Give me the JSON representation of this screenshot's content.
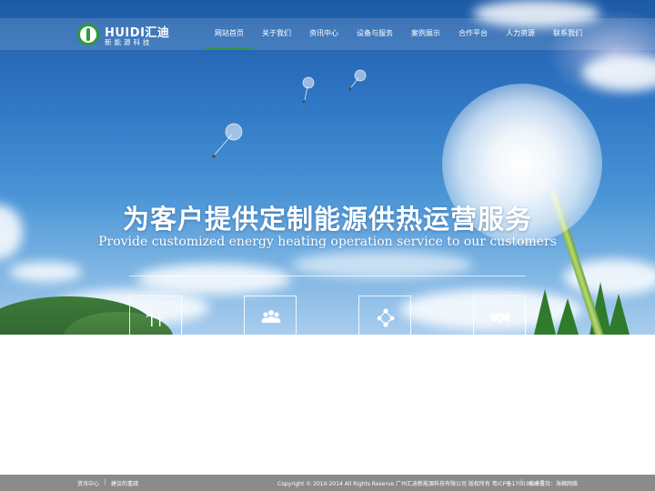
{
  "header": {
    "logo": {
      "name": "HUIDI汇迪",
      "tagline": "新能源科技"
    },
    "nav": [
      {
        "label": "网站首页",
        "active": true
      },
      {
        "label": "关于我们",
        "active": false
      },
      {
        "label": "资讯中心",
        "active": false
      },
      {
        "label": "设备与服务",
        "active": false
      },
      {
        "label": "案例展示",
        "active": false
      },
      {
        "label": "合作平台",
        "active": false
      },
      {
        "label": "人力资源",
        "active": false
      },
      {
        "label": "联系我们",
        "active": false
      }
    ]
  },
  "hero": {
    "headline": "为客户提供定制能源供热运营服务",
    "subheadline": "Provide customized energy heating operation service to our customers",
    "features": [
      {
        "icon": "wind-turbine-icon"
      },
      {
        "icon": "people-icon"
      },
      {
        "icon": "network-icon"
      },
      {
        "icon": "handshake-icon"
      }
    ]
  },
  "footer": {
    "links": [
      "资讯中心",
      "建议的重疏"
    ],
    "copyright": "Copyright © 2010-2014 All Rights Reserve 广州汇迪新能源科技有限公司 版权所有 粤ICP备17003436号",
    "support": "技术支持：海棉网络"
  },
  "colors": {
    "accent": "#2f9a3a",
    "footer_bg": "#8b8b8b"
  }
}
